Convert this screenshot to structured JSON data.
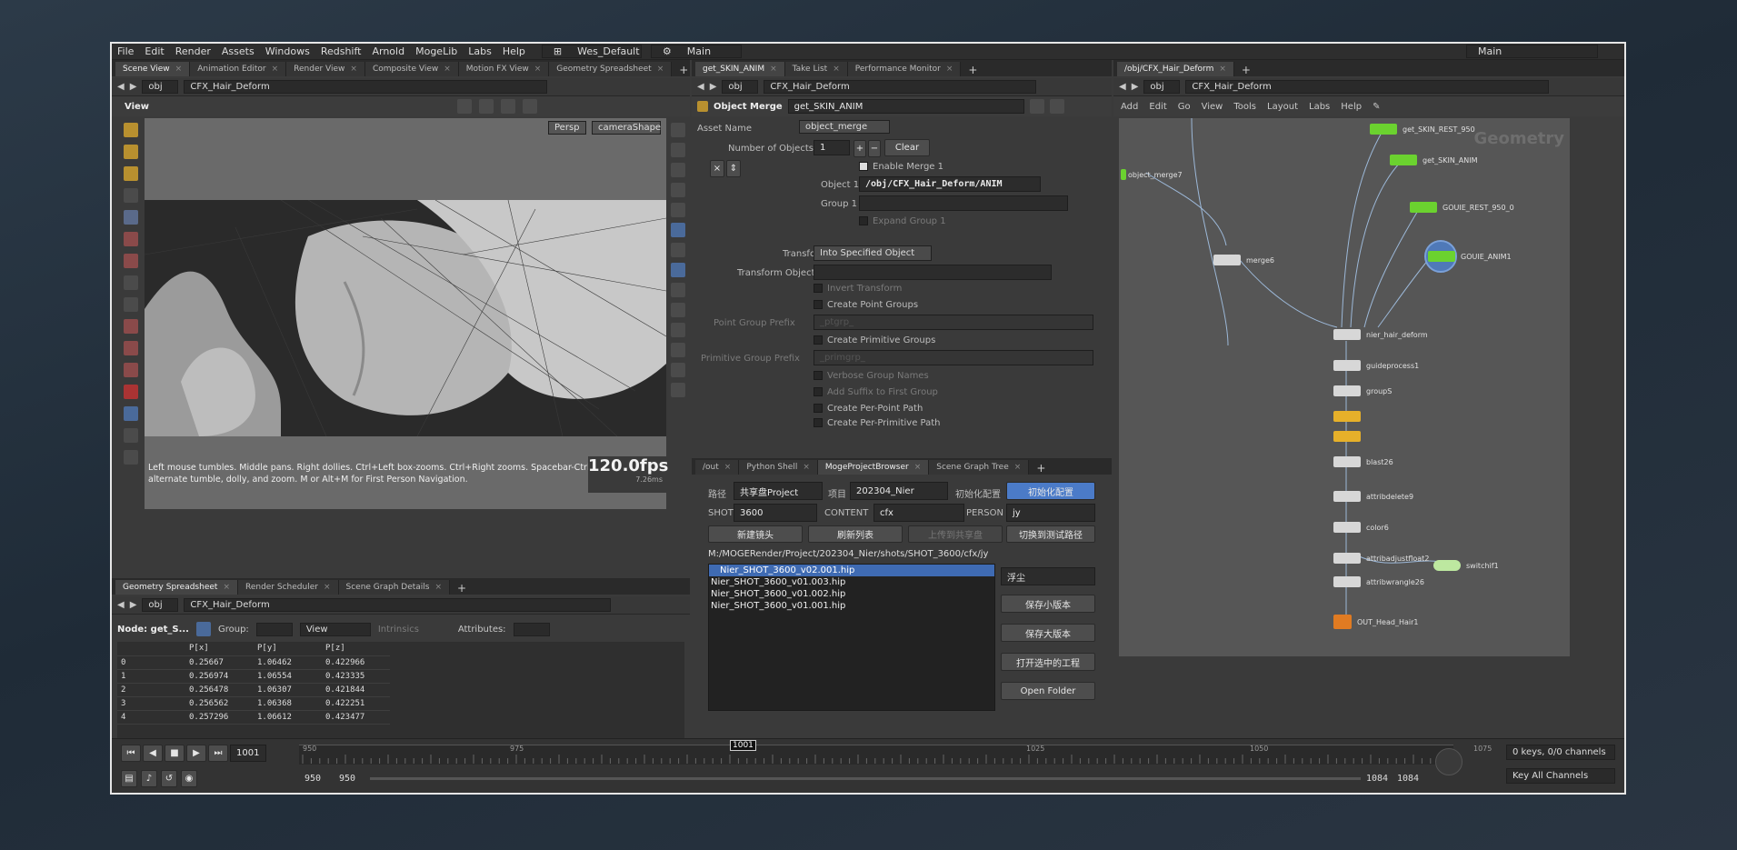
{
  "menu": [
    "File",
    "Edit",
    "Render",
    "Assets",
    "Windows",
    "Redshift",
    "Arnold",
    "MogeLib",
    "Labs",
    "Help"
  ],
  "desktop": "Wes_Default",
  "desktop_main": "Main",
  "right_main": "Main",
  "left_tabs": [
    "Scene View",
    "Animation Editor",
    "Render View",
    "Composite View",
    "Motion FX View",
    "Geometry Spreadsheet"
  ],
  "mid_tabs": [
    "get_SKIN_ANIM",
    "Take List",
    "Performance Monitor"
  ],
  "right_tabs": [
    "/obj/CFX_Hair_Deform"
  ],
  "path_obj": "obj",
  "path_node": "CFX_Hair_Deform",
  "viewport": {
    "title": "View",
    "persp": "Persp",
    "camera": "cameraShape",
    "fps": "120.0fps",
    "ms": "7.26ms",
    "hint1": "Left mouse tumbles. Middle pans. Right dollies. Ctrl+Left box-zooms. Ctrl+Right zooms. Spacebar-Ctrl-Left t",
    "hint2": "alternate tumble, dolly, and zoom.    M or Alt+M for First Person Navigation."
  },
  "params": {
    "type": "Object Merge",
    "name": "get_SKIN_ANIM",
    "asset_label": "Asset Name",
    "asset": "object_merge",
    "num_label": "Number of Objects",
    "num": "1",
    "clear": "Clear",
    "enable": "Enable Merge 1",
    "obj_label": "Object 1",
    "obj": "/obj/CFX_Hair_Deform/ANIM",
    "group_label": "Group 1",
    "expand": "Expand Group 1",
    "transform_label": "Transform",
    "transform": "Into Specified Object",
    "tobj_label": "Transform Object",
    "invert": "Invert Transform",
    "cpg": "Create Point Groups",
    "ppref_label": "Point Group Prefix",
    "ppref": "_ptgrp_",
    "cprg": "Create Primitive Groups",
    "prpref_label": "Primitive Group Prefix",
    "prpref": "_primgrp_",
    "verbose": "Verbose Group Names",
    "suffix": "Add Suffix to First Group",
    "perpoint": "Create Per-Point Path",
    "perprim": "Create Per-Primitive Path"
  },
  "bottom_tabs": [
    "/out",
    "Python Shell",
    "MogeProjectBrowser",
    "Scene Graph Tree"
  ],
  "browser": {
    "path_label": "路径",
    "path": "共享盘Project",
    "proj_label": "项目",
    "proj": "202304_Nier",
    "init_label": "初始化配置",
    "init_btn": "初始化配置",
    "shot_label": "SHOT",
    "shot": "3600",
    "content_label": "CONTENT",
    "content": "cfx",
    "person_label": "PERSON",
    "person": "jy",
    "btn_new": "新建镜头",
    "btn_refresh": "刷新列表",
    "btn_upload": "上传到共享盘",
    "btn_switch": "切换到测试路径",
    "dir": "M:/MOGERender/Project/202304_Nier/shots/SHOT_3600/cfx/jy",
    "files": [
      "Nier_SHOT_3600_v02.001.hip",
      "Nier_SHOT_3600_v01.003.hip",
      "Nier_SHOT_3600_v01.002.hip",
      "Nier_SHOT_3600_v01.001.hip"
    ],
    "note": "浮尘",
    "save_small": "保存小版本",
    "save_big": "保存大版本",
    "open_sel": "打开选中的工程",
    "open_folder": "Open Folder"
  },
  "sheet_tabs": [
    "Geometry Spreadsheet",
    "Render Scheduler",
    "Scene Graph Details"
  ],
  "sheet": {
    "node": "Node: get_S...",
    "group": "Group:",
    "view": "View",
    "intrinsics": "Intrinsics",
    "attrs": "Attributes:",
    "cols": [
      "P[x]",
      "P[y]",
      "P[z]"
    ],
    "rows": [
      [
        "0",
        "0.25667",
        "1.06462",
        "0.422966"
      ],
      [
        "1",
        "0.256974",
        "1.06554",
        "0.423335"
      ],
      [
        "2",
        "0.256478",
        "1.06307",
        "0.421844"
      ],
      [
        "3",
        "0.256562",
        "1.06368",
        "0.422251"
      ],
      [
        "4",
        "0.257296",
        "1.06612",
        "0.423477"
      ]
    ]
  },
  "net": {
    "watermark": "Geometry",
    "menu": [
      "Add",
      "Edit",
      "Go",
      "View",
      "Tools",
      "Layout",
      "Labs",
      "Help"
    ],
    "nodes": [
      "get_SKIN_REST_950",
      "get_SKIN_ANIM",
      "GOUIE_REST_950_0",
      "GOUIE_ANIM1",
      "object_merge7",
      "merge6",
      "nier_hair_deform",
      "guideprocess1",
      "groupS",
      "blast26",
      "attribdelete9",
      "color6",
      "attribadjustfloat2",
      "attribwrangle26",
      "switchif1",
      "OUT_Head_Hair1"
    ]
  },
  "timeline": {
    "frame": "1001",
    "current": "1001",
    "ticks": [
      "950",
      "975",
      "1025",
      "1050",
      "1075"
    ],
    "start1": "950",
    "start2": "950",
    "end1": "1084",
    "end2": "1084",
    "keys": "0 keys, 0/0 channels",
    "keyall": "Key All Channels"
  }
}
